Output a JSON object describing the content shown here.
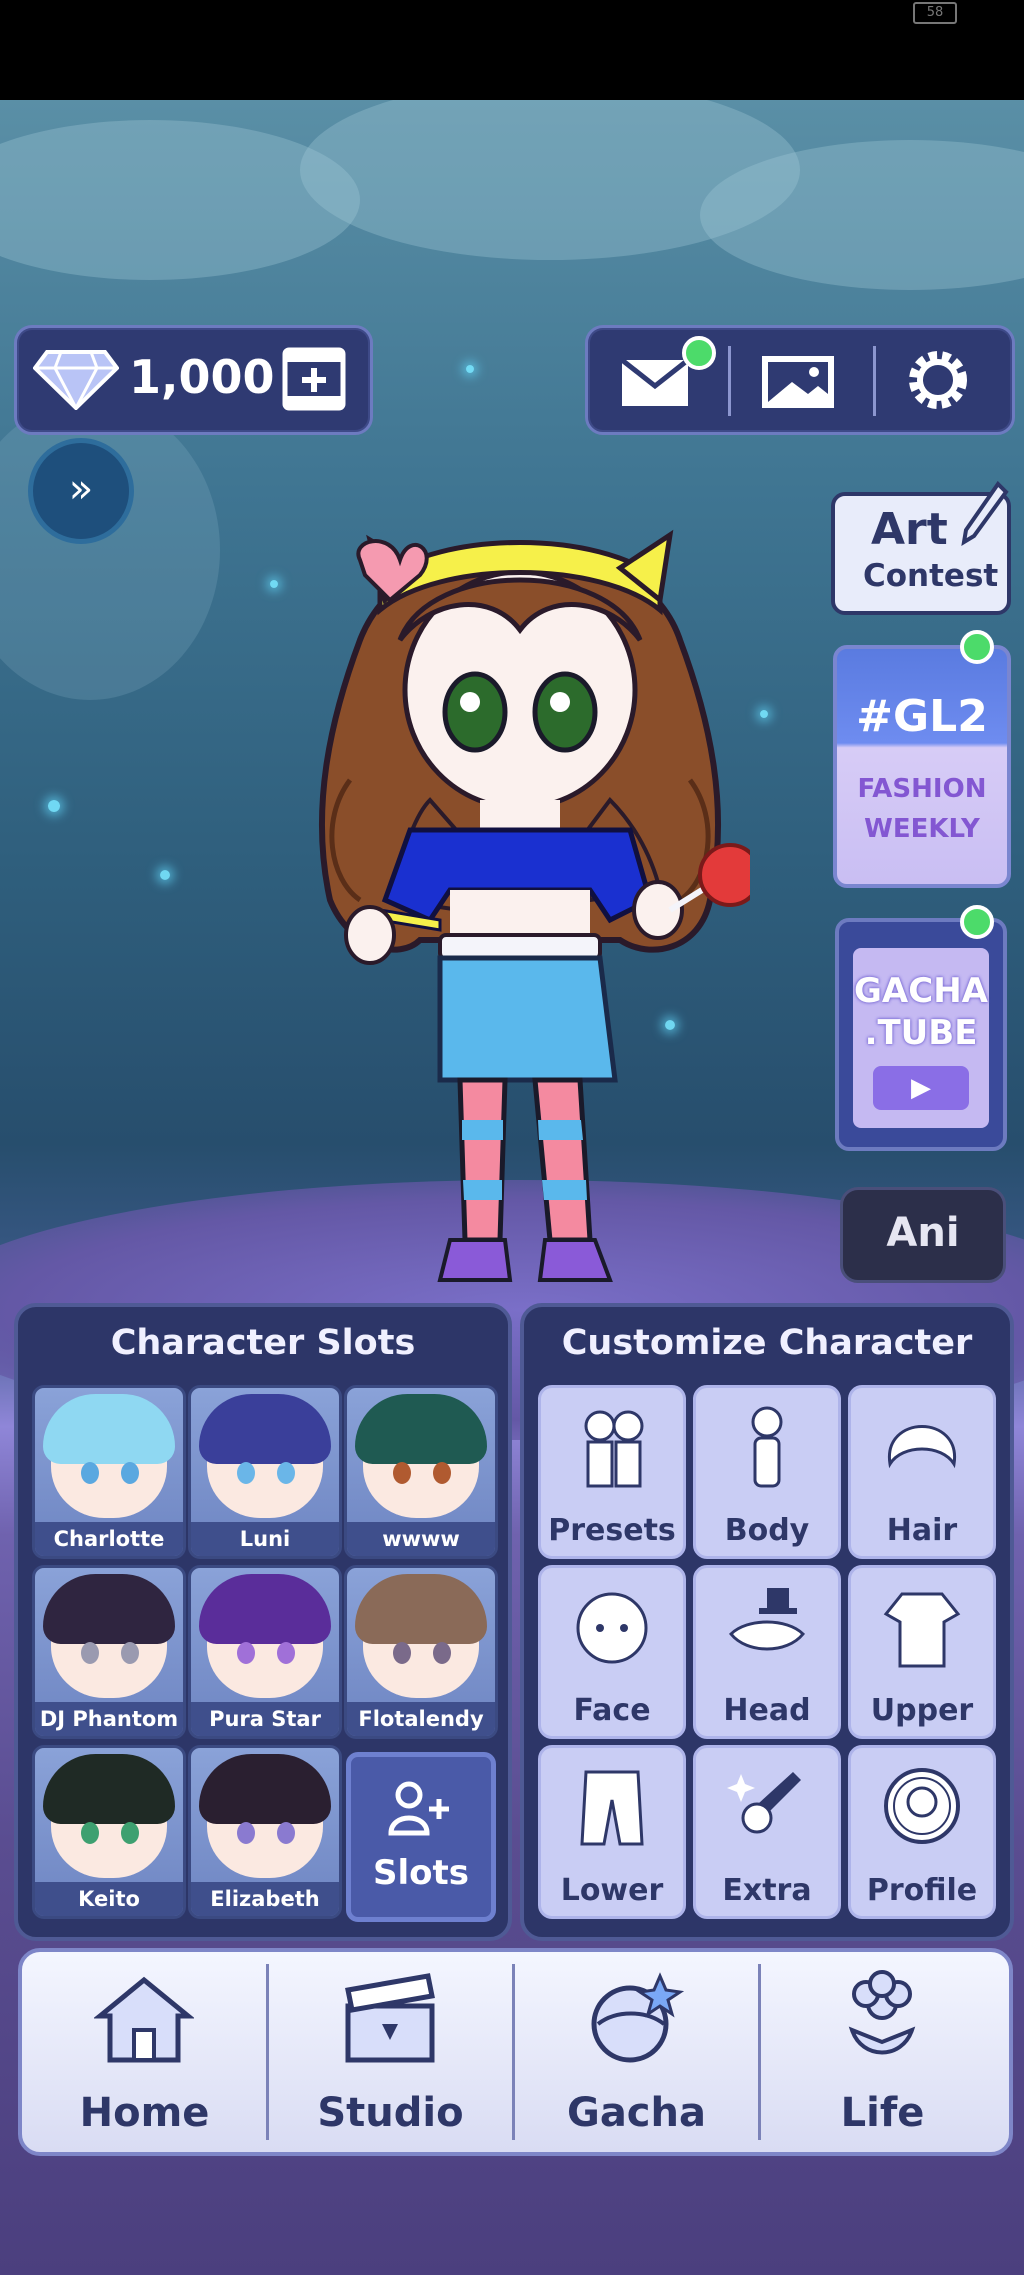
{
  "status_bar": {
    "battery": "58"
  },
  "currency": {
    "gems": "1,000",
    "icon": "diamond-icon",
    "add_icon": "add-gems-icon"
  },
  "top_icons": [
    "mail-icon",
    "gallery-icon",
    "settings-icon"
  ],
  "expand_button": {
    "label": "»"
  },
  "side": {
    "art_contest": {
      "line1": "Art",
      "line2": "Contest"
    },
    "event": {
      "line1": "#GL2",
      "line2": "FASHION",
      "line3": "WEEKLY"
    },
    "tube": {
      "line1": "GACHA",
      "line2": ".TUBE"
    },
    "ani_label": "Ani"
  },
  "character_slots": {
    "title": "Character Slots",
    "slots": [
      {
        "name": "Charlotte",
        "hair": "#8fd8f2",
        "eye": "#5aa8e0"
      },
      {
        "name": "Luni",
        "hair": "#3a3f9a",
        "eye": "#6ab6e8"
      },
      {
        "name": "wwww",
        "hair": "#1f5a52",
        "eye": "#b05a30"
      },
      {
        "name": "DJ Phantom",
        "hair": "#2f2540",
        "eye": "#9a9ab0"
      },
      {
        "name": "Pura Star",
        "hair": "#5a2d9a",
        "eye": "#a070d8"
      },
      {
        "name": "Flotalendy",
        "hair": "#8a6a58",
        "eye": "#7a6a8a"
      },
      {
        "name": "Keito",
        "hair": "#1f2a25",
        "eye": "#3ea070"
      },
      {
        "name": "Elizabeth",
        "hair": "#2a1f30",
        "eye": "#8a7ad0"
      }
    ],
    "slots_button": "Slots"
  },
  "customize": {
    "title": "Customize Character",
    "items": [
      {
        "label": "Presets",
        "icon": "presets-icon"
      },
      {
        "label": "Body",
        "icon": "body-icon"
      },
      {
        "label": "Hair",
        "icon": "hair-icon"
      },
      {
        "label": "Face",
        "icon": "face-icon"
      },
      {
        "label": "Head",
        "icon": "head-icon"
      },
      {
        "label": "Upper",
        "icon": "upper-icon"
      },
      {
        "label": "Lower",
        "icon": "lower-icon"
      },
      {
        "label": "Extra",
        "icon": "extra-icon"
      },
      {
        "label": "Profile",
        "icon": "profile-icon"
      }
    ]
  },
  "nav": [
    {
      "label": "Home",
      "icon": "home-icon"
    },
    {
      "label": "Studio",
      "icon": "clapperboard-icon"
    },
    {
      "label": "Gacha",
      "icon": "gacha-icon"
    },
    {
      "label": "Life",
      "icon": "flower-icon"
    }
  ]
}
